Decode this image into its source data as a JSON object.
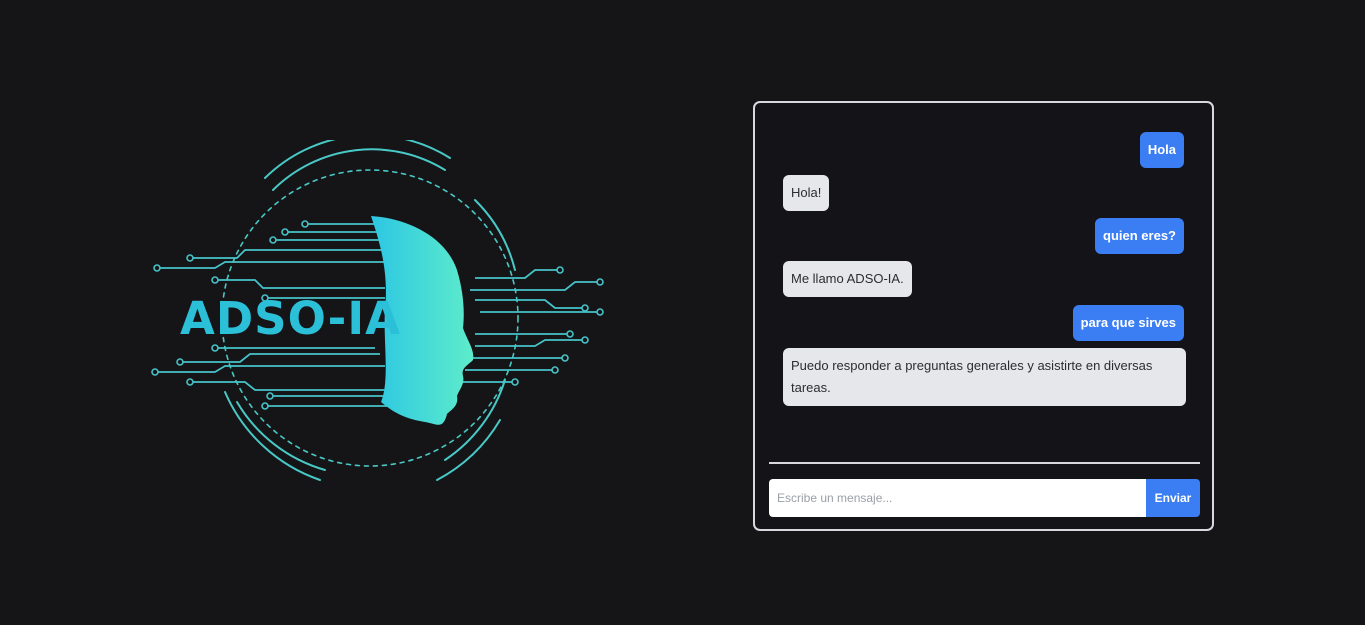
{
  "logo": {
    "text": "ADSO-IA",
    "accent": "#2bbfd8",
    "gradient": [
      "#1fa8e0",
      "#5ee6c8"
    ]
  },
  "chat": {
    "messages": [
      {
        "role": "user",
        "text": "Hola"
      },
      {
        "role": "bot",
        "text": "Hola!"
      },
      {
        "role": "user",
        "text": "quien eres?"
      },
      {
        "role": "bot",
        "text": "Me llamo ADSO-IA."
      },
      {
        "role": "user",
        "text": "para que sirves"
      },
      {
        "role": "bot",
        "text": "Puedo responder a preguntas generales y asistirte en diversas tareas."
      }
    ],
    "input_placeholder": "Escribe un mensaje...",
    "send_label": "Enviar",
    "colors": {
      "user_bubble": "#3b7ef3",
      "bot_bubble": "#e6e7eb",
      "border": "#d7d9de"
    }
  }
}
